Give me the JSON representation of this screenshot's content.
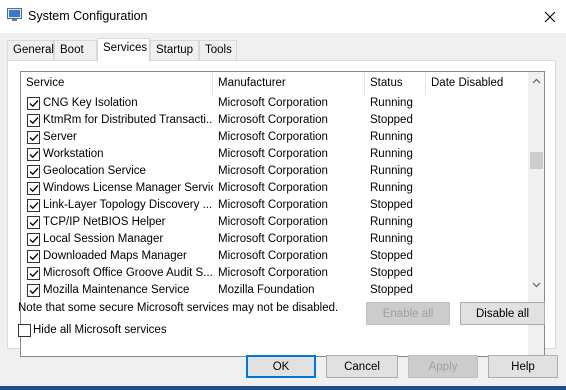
{
  "window": {
    "title": "System Configuration"
  },
  "tabs": [
    {
      "label": "General",
      "active": false
    },
    {
      "label": "Boot",
      "active": false
    },
    {
      "label": "Services",
      "active": true
    },
    {
      "label": "Startup",
      "active": false
    },
    {
      "label": "Tools",
      "active": false
    }
  ],
  "columns": {
    "service": "Service",
    "manufacturer": "Manufacturer",
    "status": "Status",
    "date_disabled": "Date Disabled"
  },
  "rows": [
    {
      "service": "CNG Key Isolation",
      "manufacturer": "Microsoft Corporation",
      "status": "Running",
      "date_disabled": "",
      "checked": true
    },
    {
      "service": "KtmRm for Distributed Transacti...",
      "manufacturer": "Microsoft Corporation",
      "status": "Stopped",
      "date_disabled": "",
      "checked": true
    },
    {
      "service": "Server",
      "manufacturer": "Microsoft Corporation",
      "status": "Running",
      "date_disabled": "",
      "checked": true
    },
    {
      "service": "Workstation",
      "manufacturer": "Microsoft Corporation",
      "status": "Running",
      "date_disabled": "",
      "checked": true
    },
    {
      "service": "Geolocation Service",
      "manufacturer": "Microsoft Corporation",
      "status": "Running",
      "date_disabled": "",
      "checked": true
    },
    {
      "service": "Windows License Manager Service",
      "manufacturer": "Microsoft Corporation",
      "status": "Running",
      "date_disabled": "",
      "checked": true
    },
    {
      "service": "Link-Layer Topology Discovery ...",
      "manufacturer": "Microsoft Corporation",
      "status": "Stopped",
      "date_disabled": "",
      "checked": true
    },
    {
      "service": "TCP/IP NetBIOS Helper",
      "manufacturer": "Microsoft Corporation",
      "status": "Running",
      "date_disabled": "",
      "checked": true
    },
    {
      "service": "Local Session Manager",
      "manufacturer": "Microsoft Corporation",
      "status": "Running",
      "date_disabled": "",
      "checked": true
    },
    {
      "service": "Downloaded Maps Manager",
      "manufacturer": "Microsoft Corporation",
      "status": "Stopped",
      "date_disabled": "",
      "checked": true
    },
    {
      "service": "Microsoft Office Groove Audit S...",
      "manufacturer": "Microsoft Corporation",
      "status": "Stopped",
      "date_disabled": "",
      "checked": true
    },
    {
      "service": "Mozilla Maintenance Service",
      "manufacturer": "Mozilla Foundation",
      "status": "Stopped",
      "date_disabled": "",
      "checked": true
    }
  ],
  "note": "Note that some secure Microsoft services may not be disabled.",
  "enable_all": "Enable all",
  "disable_all": "Disable all",
  "hide_ms_label": "Hide all Microsoft services",
  "hide_ms_checked": false,
  "buttons": {
    "ok": "OK",
    "cancel": "Cancel",
    "apply": "Apply",
    "help": "Help"
  },
  "colors": {
    "default_button_border": "#0078d7",
    "taskbar_strip": "#1c4f8f"
  }
}
